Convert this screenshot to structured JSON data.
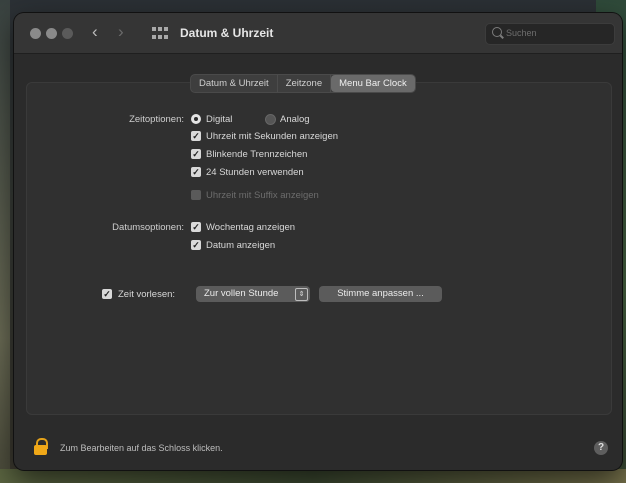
{
  "window": {
    "title": "Datum & Uhrzeit",
    "nav_back": "‹",
    "nav_forward": "›",
    "search_placeholder": "Suchen"
  },
  "tabs": [
    {
      "label": "Datum & Uhrzeit",
      "active": false
    },
    {
      "label": "Zeitzone",
      "active": false
    },
    {
      "label": "Menu Bar Clock",
      "active": true
    }
  ],
  "time_options": {
    "label": "Zeitoptionen:",
    "radio_digital": {
      "label": "Digital",
      "selected": true
    },
    "radio_analog": {
      "label": "Analog",
      "selected": false
    },
    "checkboxes": [
      {
        "label": "Uhrzeit mit Sekunden anzeigen",
        "checked": true,
        "enabled": true
      },
      {
        "label": "Blinkende Trennzeichen",
        "checked": true,
        "enabled": true
      },
      {
        "label": "24 Stunden verwenden",
        "checked": true,
        "enabled": true
      },
      {
        "label": "Uhrzeit mit Suffix anzeigen",
        "checked": false,
        "enabled": false
      }
    ]
  },
  "date_options": {
    "label": "Datumsoptionen:",
    "checkboxes": [
      {
        "label": "Wochentag anzeigen",
        "checked": true
      },
      {
        "label": "Datum anzeigen",
        "checked": true
      }
    ]
  },
  "announce": {
    "checkbox_label": "Zeit vorlesen:",
    "checked": true,
    "popup_value": "Zur vollen Stunde",
    "voice_button": "Stimme anpassen ..."
  },
  "footer": {
    "lock_text": "Zum Bearbeiten auf das Schloss klicken.",
    "help": "?"
  },
  "colors": {
    "window_bg": "#2b2b2b",
    "panel_bg": "#303030",
    "lock_accent": "#f0a818"
  }
}
